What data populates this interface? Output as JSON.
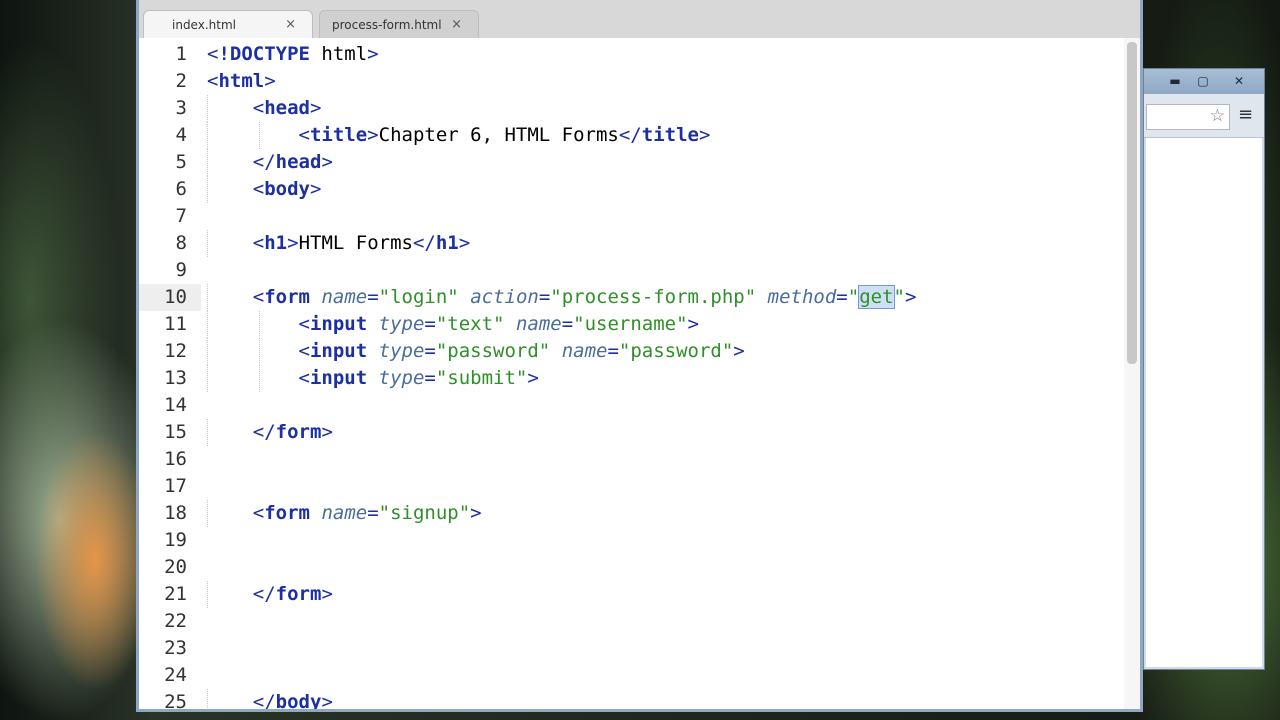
{
  "browser_window": {
    "minimize": "▬",
    "maximize": "▢",
    "close": "✕",
    "bookmark_icon": "☆",
    "menu_icon": "≡"
  },
  "tabs": [
    {
      "label": "index.html",
      "close": "×",
      "active": true
    },
    {
      "label": "process-form.html",
      "close": "×",
      "active": false
    }
  ],
  "editor": {
    "current_line": 10,
    "selected_text": "get",
    "lines": [
      {
        "n": "1",
        "t": "<!DOCTYPE html>"
      },
      {
        "n": "2",
        "t": "<html>"
      },
      {
        "n": "3",
        "t": "    <head>"
      },
      {
        "n": "4",
        "t": "        <title>Chapter 6, HTML Forms</title>"
      },
      {
        "n": "5",
        "t": "    </head>"
      },
      {
        "n": "6",
        "t": "    <body>"
      },
      {
        "n": "7",
        "t": ""
      },
      {
        "n": "8",
        "t": "    <h1>HTML Forms</h1>"
      },
      {
        "n": "9",
        "t": ""
      },
      {
        "n": "10",
        "t": "    <form name=\"login\" action=\"process-form.php\" method=\"get\">"
      },
      {
        "n": "11",
        "t": "        <input type=\"text\" name=\"username\">"
      },
      {
        "n": "12",
        "t": "        <input type=\"password\" name=\"password\">"
      },
      {
        "n": "13",
        "t": "        <input type=\"submit\">"
      },
      {
        "n": "14",
        "t": ""
      },
      {
        "n": "15",
        "t": "    </form>"
      },
      {
        "n": "16",
        "t": ""
      },
      {
        "n": "17",
        "t": ""
      },
      {
        "n": "18",
        "t": "    <form name=\"signup\">"
      },
      {
        "n": "19",
        "t": ""
      },
      {
        "n": "20",
        "t": ""
      },
      {
        "n": "21",
        "t": "    </form>"
      },
      {
        "n": "22",
        "t": ""
      },
      {
        "n": "23",
        "t": ""
      },
      {
        "n": "24",
        "t": ""
      },
      {
        "n": "25",
        "t": "    </body>"
      }
    ]
  },
  "colors": {
    "tag": "#1c2fa3",
    "attribute": "#4a6d9c",
    "string": "#2f8f28",
    "selection": "#cfe0f4"
  }
}
